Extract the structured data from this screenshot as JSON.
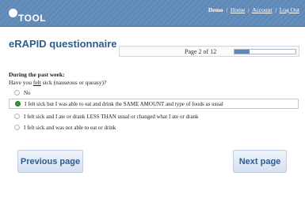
{
  "header": {
    "logo_text": "TOOL",
    "user": "Demo",
    "links": [
      "Home",
      "Account",
      "Log Out"
    ],
    "separator": "|"
  },
  "title": "eRAPID questionnaire",
  "pagination": {
    "text": "Page 2 of 12",
    "progress_fraction": 0.25
  },
  "question": {
    "heading": "During the past week:",
    "text_before": "Have you ",
    "text_underlined": "felt",
    "text_after": " sick (nauseous or queasy)?"
  },
  "options": [
    {
      "label": "No",
      "selected": false
    },
    {
      "label": "I felt sick but I was able to eat and drink the SAME AMOUNT and type of foods as usual",
      "selected": true
    },
    {
      "label": "I felt sick and I ate or drank LESS THAN usual or changed what I ate or drank",
      "selected": false
    },
    {
      "label": "I felt sick and was not able to eat or drink",
      "selected": false
    }
  ],
  "buttons": {
    "previous": "Previous page",
    "next": "Next page"
  },
  "colors": {
    "header": "#5e88b8",
    "title": "#2d5c91",
    "selected_radio": "#2e9d2e"
  }
}
